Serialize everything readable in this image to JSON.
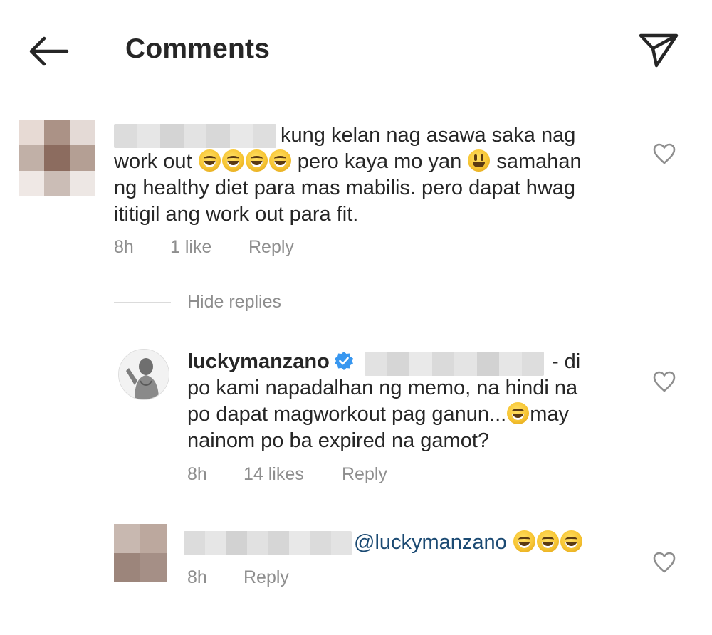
{
  "header": {
    "title": "Comments",
    "back_icon": "arrow-left-icon",
    "send_icon": "paper-plane-icon"
  },
  "comments": [
    {
      "text_line1": "kung kelan nag asawa saka nag",
      "text_line2_a": "work out",
      "text_line2_b": " pero kaya mo yan",
      "text_line2_c": " samahan",
      "text_line3": "ng healthy diet para mas mabilis. pero dapat hwag",
      "text_line4": "ititigil ang work out para fit.",
      "time": "8h",
      "likes": "1 like",
      "reply": "Reply"
    }
  ],
  "hide_replies": "Hide replies",
  "replies": [
    {
      "username": "luckymanzano",
      "text_line1": "- di",
      "text_line2": "po kami napadalhan ng memo, na hindi na",
      "text_line3_a": "po dapat magworkout pag ganun...",
      "text_line3_b": "may",
      "text_line4": "nainom po ba expired na gamot?",
      "time": "8h",
      "likes": "14 likes",
      "reply": "Reply"
    },
    {
      "mention": "@luckymanzano",
      "time": "8h",
      "reply": "Reply"
    }
  ],
  "colors": {
    "text": "#262626",
    "meta": "#8e8e8e",
    "mention": "#1b4a73",
    "verified": "#3897f0"
  }
}
